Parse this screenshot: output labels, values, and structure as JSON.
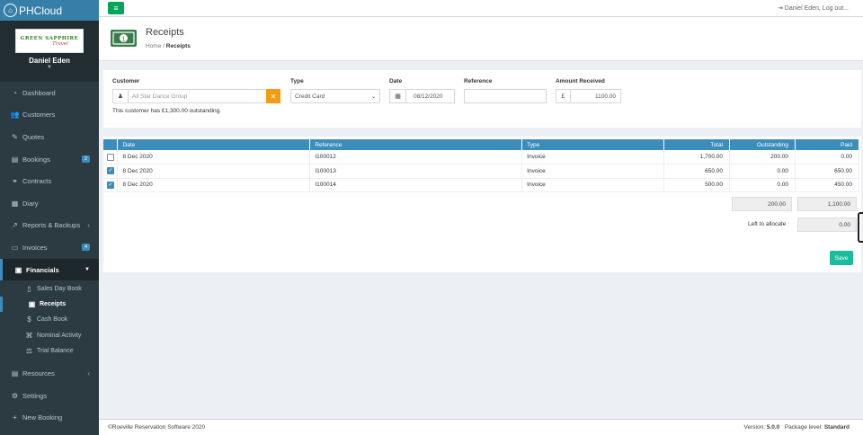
{
  "app": {
    "logo_text": "PHCloud"
  },
  "user_panel": {
    "brand_line1": "GREEN SAPPHIRE",
    "brand_line2": "Travel",
    "name": "Daniel Eden"
  },
  "topbar": {
    "user_menu": "Daniel Eden, Log out..."
  },
  "sidebar": {
    "items": [
      {
        "label": "Dashboard",
        "icon": "dashboard-icon"
      },
      {
        "label": "Customers",
        "icon": "users-icon"
      },
      {
        "label": "Quotes",
        "icon": "pencil-icon"
      },
      {
        "label": "Bookings",
        "icon": "book-icon",
        "badge": "2"
      },
      {
        "label": "Contracts",
        "icon": "handshake-icon"
      },
      {
        "label": "Diary",
        "icon": "calendar-icon"
      },
      {
        "label": "Reports & Backups",
        "icon": "chart-icon"
      },
      {
        "label": "Invoices",
        "icon": "invoice-icon",
        "badge": "4"
      },
      {
        "label": "Financials",
        "icon": "money-icon"
      }
    ],
    "financials_sub": [
      {
        "label": "Sales Day Book"
      },
      {
        "label": "Receipts"
      },
      {
        "label": "Cash Book"
      },
      {
        "label": "Nominal Activity"
      },
      {
        "label": "Trial Balance"
      }
    ],
    "lower": [
      {
        "label": "Resources",
        "icon": "resources-icon"
      },
      {
        "label": "Settings",
        "icon": "cogs-icon"
      },
      {
        "label": "New Booking",
        "icon": "plus-icon"
      }
    ]
  },
  "page": {
    "title": "Receipts",
    "breadcrumb_home": "Home",
    "breadcrumb_sep": "/",
    "breadcrumb_current": "Receipts"
  },
  "form": {
    "customer_label": "Customer",
    "customer_value": "All Star Dance Group",
    "type_label": "Type",
    "type_value": "Credit Card",
    "date_label": "Date",
    "date_value": "08/12/2020",
    "reference_label": "Reference",
    "reference_value": "",
    "amount_label": "Amount Received",
    "amount_currency": "£",
    "amount_value": "1100.00",
    "outstanding_message": "This customer has £1,300.00 outstanding."
  },
  "table": {
    "headers": [
      "Date",
      "Reference",
      "Type",
      "Total",
      "Outstanding",
      "Paid"
    ],
    "rows": [
      {
        "checked": false,
        "date": "8 Dec 2020",
        "reference": "I100012",
        "type": "Invoice",
        "total": "1,700.00",
        "outstanding": "200.00",
        "paid": "0.00"
      },
      {
        "checked": true,
        "date": "8 Dec 2020",
        "reference": "I100013",
        "type": "Invoice",
        "total": "650.00",
        "outstanding": "0.00",
        "paid": "650.00"
      },
      {
        "checked": true,
        "date": "8 Dec 2020",
        "reference": "I100014",
        "type": "Invoice",
        "total": "500.00",
        "outstanding": "0.00",
        "paid": "450.00"
      }
    ],
    "sum_outstanding": "200.00",
    "sum_paid": "1,100.00",
    "left_to_allocate_label": "Left to allocate",
    "left_to_allocate_value": "0.00"
  },
  "actions": {
    "save_label": "Save"
  },
  "footer": {
    "copyright": "©Roeville Reservation Software 2020",
    "version_label": "Version:",
    "version": "5.0.0",
    "package_label": "Package level:",
    "package": "Standard"
  },
  "colors": {
    "primary": "#3c8dbc",
    "sidebar": "#2c3b41",
    "success": "#00a65a",
    "warning": "#f39c12",
    "save": "#1abc9c"
  }
}
